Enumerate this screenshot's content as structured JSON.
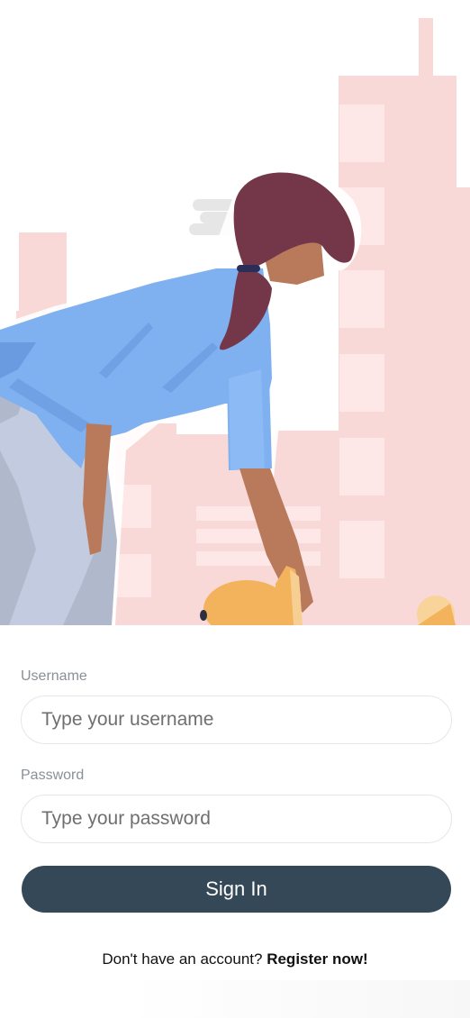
{
  "form": {
    "username_label": "Username",
    "username_placeholder": "Type your username",
    "username_value": "",
    "password_label": "Password",
    "password_placeholder": "Type your password",
    "password_value": "",
    "signin_label": "Sign In",
    "register_prompt": "Don't have an account?",
    "register_link": "Register now!"
  },
  "colors": {
    "button_bg": "#344858",
    "button_text": "#ffffff",
    "label_text": "#8a8f98",
    "city_pink": "#f9d9d8",
    "shirt_blue": "#7fb0f0",
    "hair": "#74374a",
    "skin": "#b97a5c",
    "dog": "#f2b35c"
  },
  "illustration": {
    "icon": "woman-bending-to-pet-dog-illustration"
  }
}
